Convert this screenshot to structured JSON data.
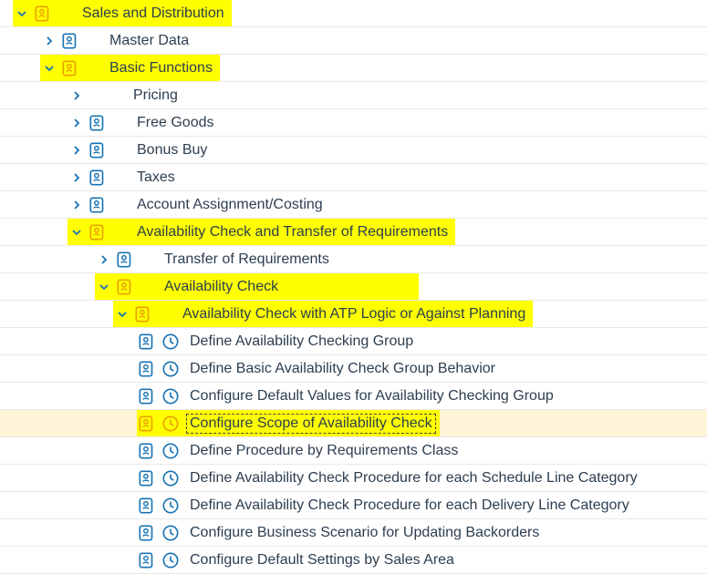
{
  "tree": {
    "sales_distribution": "Sales and Distribution",
    "master_data": "Master Data",
    "basic_functions": "Basic Functions",
    "pricing": "Pricing",
    "free_goods": "Free Goods",
    "bonus_buy": "Bonus Buy",
    "taxes": "Taxes",
    "account_assignment": "Account Assignment/Costing",
    "avail_check_transfer": "Availability Check and Transfer of Requirements",
    "transfer_req": "Transfer of Requirements",
    "avail_check": "Availability Check",
    "avail_check_atp": "Availability Check with ATP Logic or Against Planning",
    "define_group": "Define Availability Checking Group",
    "define_basic_behavior": "Define Basic Availability Check Group Behavior",
    "configure_defaults": "Configure Default Values for Availability Checking Group",
    "configure_scope": "Configure Scope of Availability Check",
    "define_proc_class": "Define Procedure by Requirements Class",
    "define_proc_schedule": "Define Availability Check Procedure for each Schedule Line Category",
    "define_proc_delivery": "Define Availability Check Procedure for each Delivery Line Category",
    "configure_backorders": "Configure Business Scenario for Updating Backorders",
    "configure_sales_area": "Configure Default Settings by Sales Area"
  },
  "colors": {
    "iconBlue": "#1873B4",
    "iconYellow": "#E9A100"
  }
}
